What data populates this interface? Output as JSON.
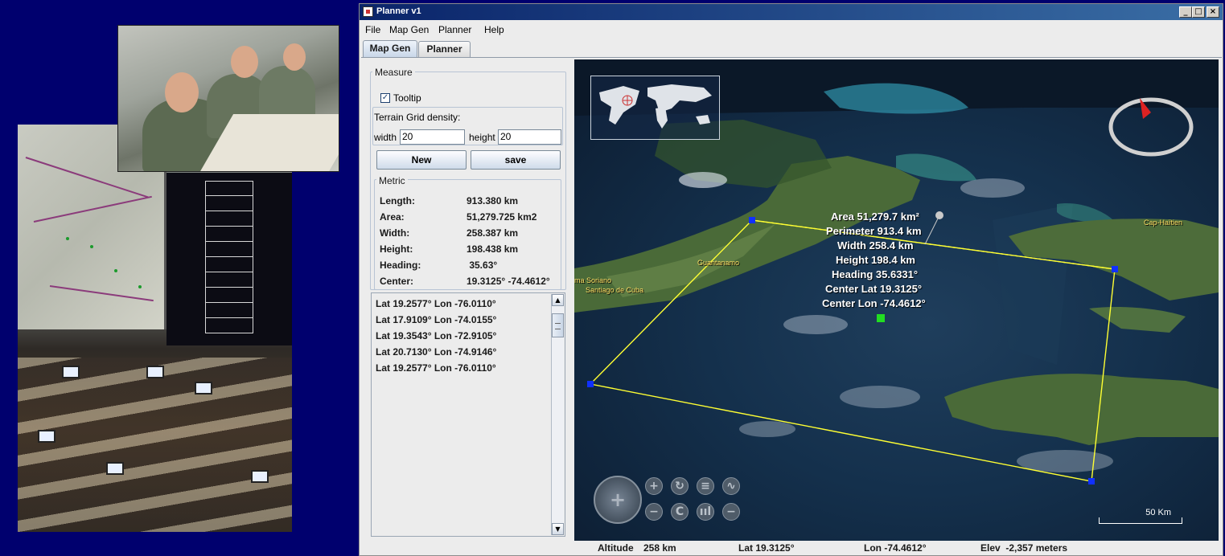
{
  "window": {
    "title": "Planner v1",
    "controls": {
      "minimize": "_",
      "maximize": "□",
      "close": "×"
    }
  },
  "menu": [
    "File",
    "Map Gen",
    "Planner",
    "Help"
  ],
  "tabs": [
    {
      "label": "Map Gen",
      "active": true
    },
    {
      "label": "Planner",
      "active": false
    }
  ],
  "measure": {
    "group_title": "Measure",
    "tooltip_label": "Tooltip",
    "tooltip_checked": true,
    "checkmark": "✓",
    "terrain_title": "Terrain Grid density:",
    "width_label": "width",
    "width_value": "20",
    "height_label": "height",
    "height_value": "20",
    "new_button": "New",
    "save_button": "save",
    "metric_title": "Metric",
    "metrics": [
      {
        "label": "Length:",
        "value": "913.380 km"
      },
      {
        "label": "Area:",
        "value": "51,279.725 km2"
      },
      {
        "label": "Width:",
        "value": "258.387 km"
      },
      {
        "label": "Height:",
        "value": "198.438 km"
      },
      {
        "label": "Heading:",
        "value": " 35.63°"
      },
      {
        "label": "Center:",
        "value": "19.3125° -74.4612°"
      }
    ],
    "points": [
      "Lat 19.2577°  Lon -76.0110°",
      "Lat 17.9109°  Lon -74.0155°",
      "Lat 19.3543°  Lon -72.9105°",
      "Lat 20.7130°  Lon -74.9146°",
      "Lat 19.2577°  Lon -76.0110°"
    ],
    "scroll_up": "▲",
    "scroll_down": "▼"
  },
  "globe": {
    "annotation": [
      "Area 51,279.7 km²",
      "Perimeter 913.4 km",
      "Width 258.4 km",
      "Height 198.4 km",
      "Heading 35.6331°",
      "Center Lat 19.3125°",
      "Center Lon -74.4612°"
    ],
    "places": {
      "guantanamo": "Guantanamo",
      "santiago": "Santiago de Cuba",
      "soriano": "ma Soriano",
      "cap_haitien": "Cap-Haïtien"
    },
    "scale": "50 Km",
    "controls": {
      "zoom_in": "+",
      "zoom_out": "−",
      "rotate": "↻",
      "reset": "C",
      "tilt": "≡",
      "terrain": "∿",
      "bars": "ııl",
      "minus2": "−"
    },
    "polygon_color": "#ffff33",
    "vertex_color": "#1030ff",
    "center_color": "#22dd22"
  },
  "status": {
    "altitude_label": "Altitude",
    "altitude_value": "258 km",
    "lat": "Lat 19.3125°",
    "lon": "Lon -74.4612°",
    "elev": "Elev  -2,357 meters"
  }
}
